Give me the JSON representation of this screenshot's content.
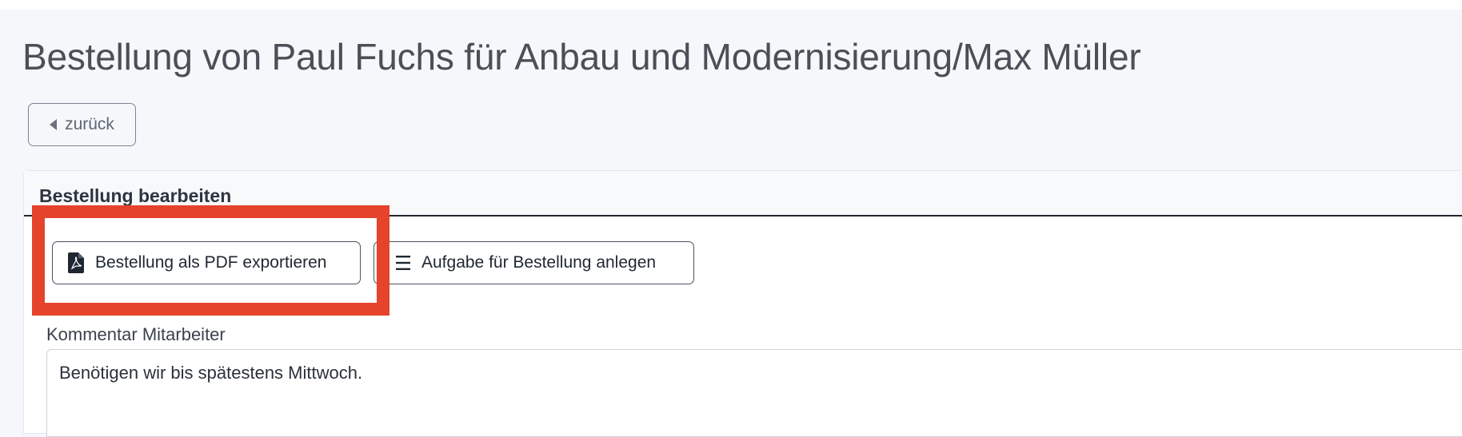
{
  "page": {
    "title": "Bestellung von Paul Fuchs für Anbau und Modernisierung/Max Müller"
  },
  "back_button": {
    "label": "zurück",
    "icon": "caret-left-icon"
  },
  "card": {
    "title": "Bestellung bearbeiten",
    "actions": [
      {
        "label": "Bestellung als PDF exportieren",
        "icon": "file-pdf-icon"
      },
      {
        "label": "Aufgabe für Bestellung anlegen",
        "icon": "list-icon"
      }
    ],
    "comment_field": {
      "label": "Kommentar Mitarbeiter",
      "value": "Benötigen wir bis spätestens Mittwoch."
    }
  },
  "colors": {
    "page_background": "#f6f7fb",
    "highlight": "#e5432b",
    "header_rule": "#23272e"
  }
}
